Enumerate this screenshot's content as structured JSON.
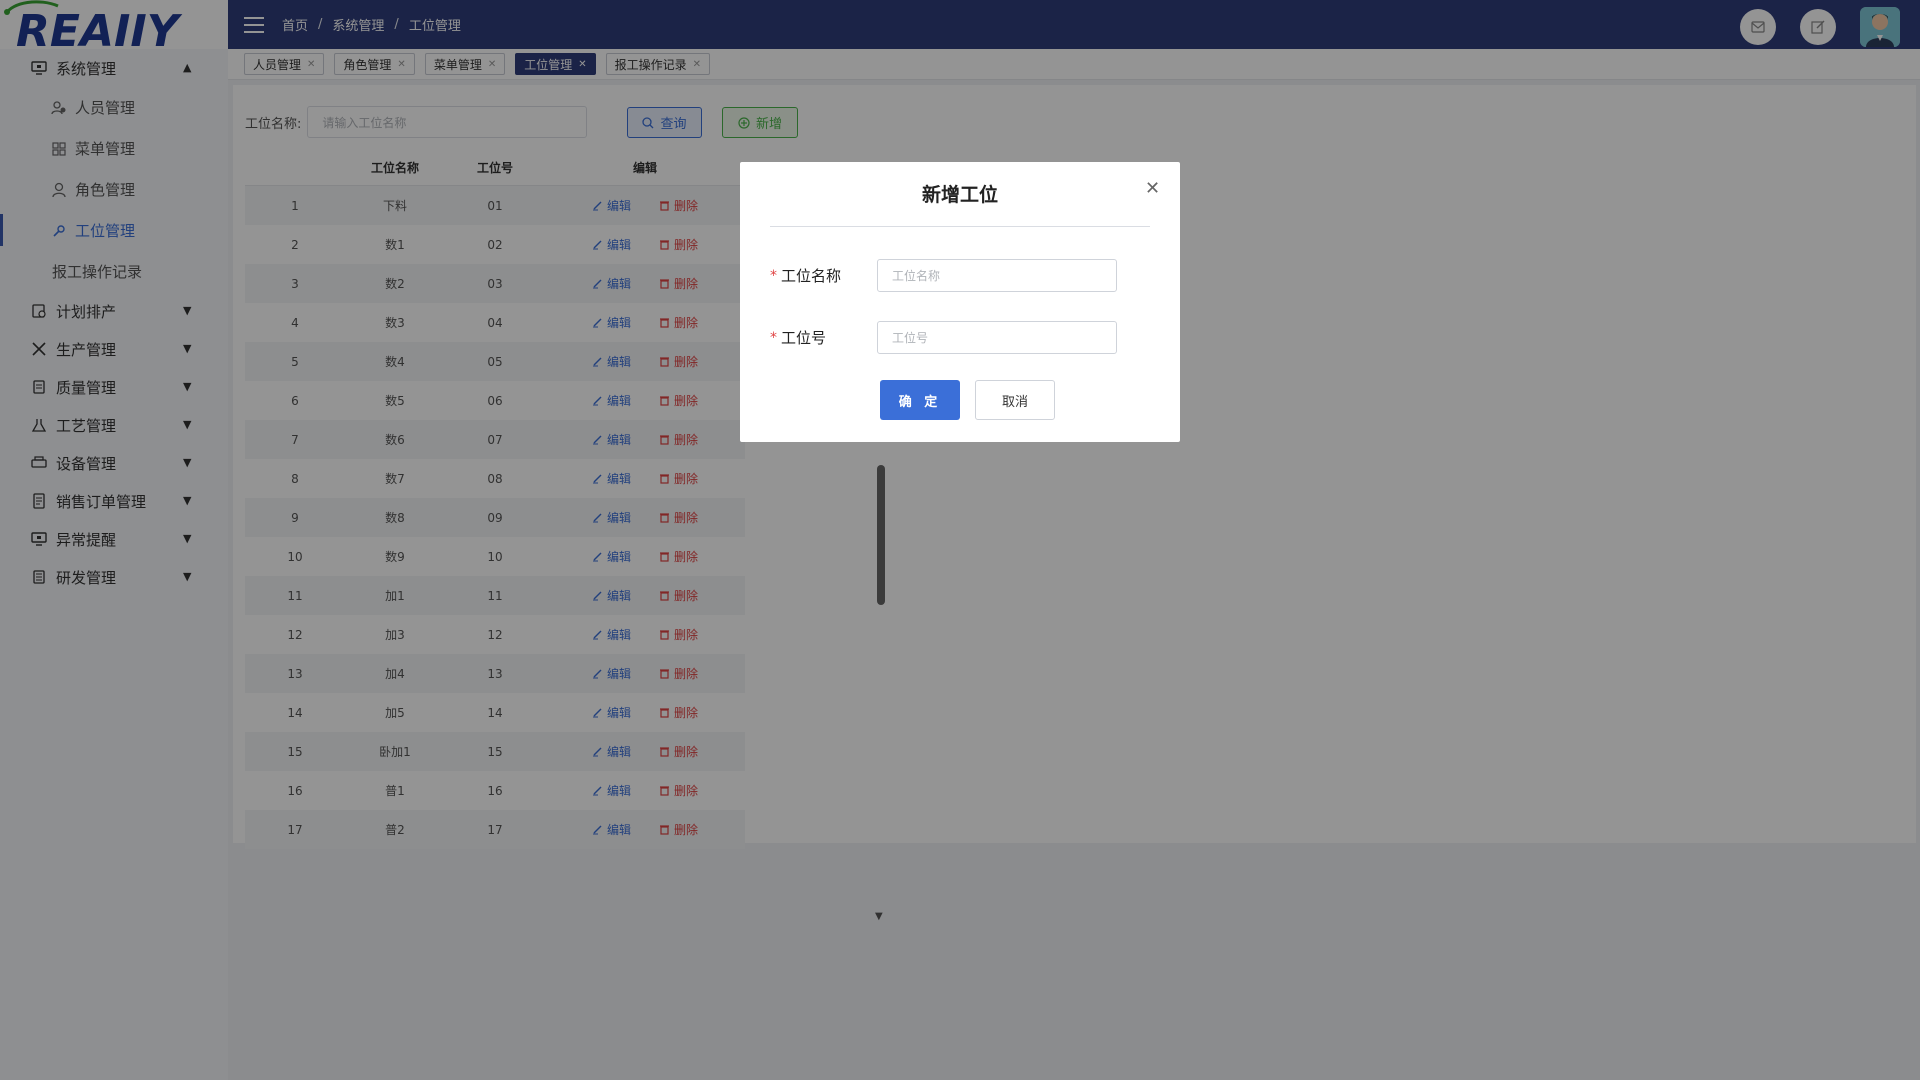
{
  "logo": {
    "text": "REAIIY"
  },
  "sidebar": {
    "system_group": {
      "label": "系统管理",
      "icon": "monitor-icon"
    },
    "system_items": [
      {
        "label": "人员管理",
        "icon": "users-icon",
        "active": false
      },
      {
        "label": "菜单管理",
        "icon": "grid-icon",
        "active": false
      },
      {
        "label": "角色管理",
        "icon": "user-icon",
        "active": false
      },
      {
        "label": "工位管理",
        "icon": "wrench-icon",
        "active": true
      },
      {
        "label": "报工操作记录",
        "icon": "",
        "active": false
      }
    ],
    "groups": [
      {
        "label": "计划排产",
        "icon": "calendar-icon"
      },
      {
        "label": "生产管理",
        "icon": "tools-icon"
      },
      {
        "label": "质量管理",
        "icon": "clipboard-icon"
      },
      {
        "label": "工艺管理",
        "icon": "flask-icon"
      },
      {
        "label": "设备管理",
        "icon": "printer-icon"
      },
      {
        "label": "销售订单管理",
        "icon": "document-icon"
      },
      {
        "label": "异常提醒",
        "icon": "monitor-icon"
      },
      {
        "label": "研发管理",
        "icon": "notes-icon"
      }
    ]
  },
  "topbar": {
    "breadcrumb": [
      "首页",
      "系统管理",
      "工位管理"
    ],
    "separator": "/"
  },
  "tabs": [
    {
      "label": "人员管理",
      "active": false
    },
    {
      "label": "角色管理",
      "active": false
    },
    {
      "label": "菜单管理",
      "active": false
    },
    {
      "label": "工位管理",
      "active": true
    },
    {
      "label": "报工操作记录",
      "active": false
    }
  ],
  "filter": {
    "label": "工位名称:",
    "placeholder": "请输入工位名称",
    "query_label": "查询",
    "add_label": "新增"
  },
  "table": {
    "headers": [
      "",
      "工位名称",
      "工位号",
      "编辑"
    ],
    "edit_label": "编辑",
    "delete_label": "删除",
    "rows": [
      [
        "1",
        "下料",
        "01"
      ],
      [
        "2",
        "数1",
        "02"
      ],
      [
        "3",
        "数2",
        "03"
      ],
      [
        "4",
        "数3",
        "04"
      ],
      [
        "5",
        "数4",
        "05"
      ],
      [
        "6",
        "数5",
        "06"
      ],
      [
        "7",
        "数6",
        "07"
      ],
      [
        "8",
        "数7",
        "08"
      ],
      [
        "9",
        "数8",
        "09"
      ],
      [
        "10",
        "数9",
        "10"
      ],
      [
        "11",
        "加1",
        "11"
      ],
      [
        "12",
        "加3",
        "12"
      ],
      [
        "13",
        "加4",
        "13"
      ],
      [
        "14",
        "加5",
        "14"
      ],
      [
        "15",
        "卧加1",
        "15"
      ],
      [
        "16",
        "普1",
        "16"
      ],
      [
        "17",
        "普2",
        "17"
      ]
    ]
  },
  "modal": {
    "title": "新增工位",
    "fields": [
      {
        "required_mark": "*",
        "label": "工位名称",
        "placeholder": "工位名称"
      },
      {
        "required_mark": "*",
        "label": "工位号",
        "placeholder": "工位号"
      }
    ],
    "ok_label": "确 定",
    "cancel_label": "取消"
  },
  "colors": {
    "topbar": "#2f3d7a",
    "primary": "#3b6fd8",
    "danger": "#e04343",
    "success": "#4bb44b"
  }
}
